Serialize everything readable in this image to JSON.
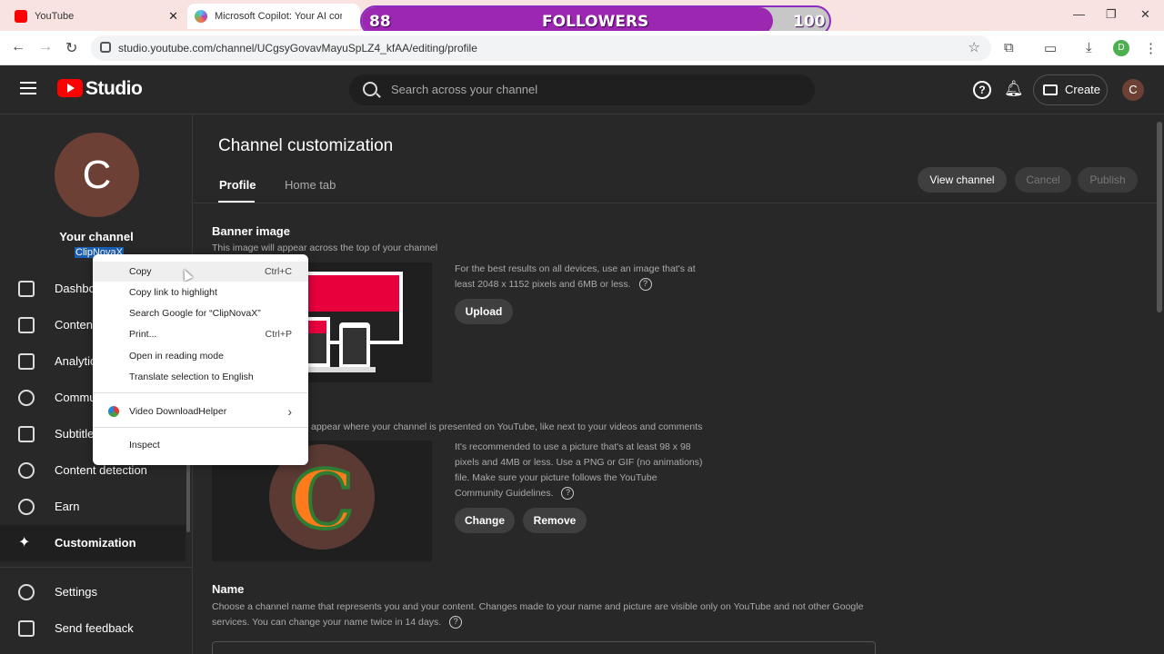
{
  "browser": {
    "tabs": [
      {
        "title": "YouTube"
      },
      {
        "title": "Microsoft Copilot: Your AI com"
      }
    ],
    "url": "studio.youtube.com/channel/UCgsyGovavMayuSpLZ4_kfAA/editing/profile",
    "profile_initial": "D"
  },
  "overlay": {
    "left_value": "88",
    "label": "FOLLOWERS",
    "right_value": "100",
    "progress_fraction": 0.88,
    "fill_color": "#9c27b0"
  },
  "header": {
    "logo": "Studio",
    "search_placeholder": "Search across your channel",
    "create_label": "Create",
    "avatar_initial": "C",
    "help_glyph": "?"
  },
  "sidebar": {
    "avatar_initial": "C",
    "channel_title": "Your channel",
    "handle": "ClipNovaX",
    "items": [
      {
        "label": "Dashboard",
        "icon": "dashboard-icon"
      },
      {
        "label": "Content",
        "icon": "content-icon"
      },
      {
        "label": "Analytics",
        "icon": "analytics-icon"
      },
      {
        "label": "Community",
        "icon": "community-icon"
      },
      {
        "label": "Subtitles",
        "icon": "subtitles-icon"
      },
      {
        "label": "Content detection",
        "icon": "copyright-icon"
      },
      {
        "label": "Earn",
        "icon": "dollar-icon"
      },
      {
        "label": "Customization",
        "icon": "magic-wand-icon",
        "active": true
      }
    ],
    "footer": [
      {
        "label": "Settings",
        "icon": "gear-icon"
      },
      {
        "label": "Send feedback",
        "icon": "feedback-icon"
      }
    ]
  },
  "main": {
    "title": "Channel customization",
    "tabs": [
      "Profile",
      "Home tab"
    ],
    "buttons": {
      "view": "View channel",
      "cancel": "Cancel",
      "publish": "Publish"
    },
    "banner": {
      "title": "Banner image",
      "desc": "This image will appear across the top of your channel",
      "hint": "For the best results on all devices, use an image that's at least 2048 x 1152 pixels and 6MB or less.",
      "upload": "Upload"
    },
    "picture": {
      "desc_tail": "appear where your channel is presented on YouTube, like next to your videos and comments",
      "hint": "It's recommended to use a picture that's at least 98 x 98 pixels and 4MB or less. Use a PNG or GIF (no animations) file. Make sure your picture follows the YouTube Community Guidelines.",
      "change": "Change",
      "remove": "Remove",
      "logo_letter": "C"
    },
    "name": {
      "title": "Name",
      "desc": "Choose a channel name that represents you and your content. Changes made to your name and picture are visible only on YouTube and not other Google services. You can change your name twice in 14 days."
    }
  },
  "context_menu": {
    "items": [
      {
        "label": "Copy",
        "shortcut": "Ctrl+C"
      },
      {
        "label": "Copy link to highlight",
        "shortcut": ""
      },
      {
        "label": "Search Google for “ClipNovaX”",
        "shortcut": ""
      },
      {
        "label": "Print...",
        "shortcut": "Ctrl+P"
      },
      {
        "label": "Open in reading mode",
        "shortcut": ""
      },
      {
        "label": "Translate selection to English",
        "shortcut": ""
      },
      {
        "label": "Video DownloadHelper",
        "shortcut": "›"
      },
      {
        "label": "Inspect",
        "shortcut": ""
      }
    ]
  }
}
